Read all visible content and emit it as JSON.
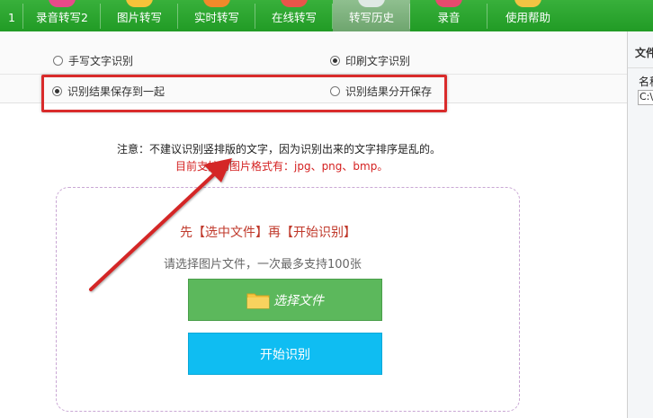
{
  "toolbar": {
    "tabs": [
      {
        "label": "1"
      },
      {
        "label": "录音转写2"
      },
      {
        "label": "图片转写"
      },
      {
        "label": "实时转写"
      },
      {
        "label": "在线转写"
      },
      {
        "label": "转写历史"
      },
      {
        "label": "录音"
      },
      {
        "label": "使用帮助"
      }
    ],
    "active_tab": "转写历史",
    "tab_icon_colors": [
      "#e84a8a",
      "#f1a02b",
      "#f4c33a",
      "#f08a2a",
      "#e9554a",
      "#dfe9e4",
      "#e74a6e",
      "#f2c443"
    ]
  },
  "options": {
    "handwriting_label": "手写文字识别",
    "print_label": "印刷文字识别",
    "save_together_label": "识别结果保存到一起",
    "save_separate_label": "识别结果分开保存",
    "recognition_mode": "印刷文字识别",
    "save_mode": "识别结果保存到一起"
  },
  "notes": {
    "line1": "注意：不建议识别竖排版的文字，因为识别出来的文字排序是乱的。",
    "line2": "目前支持的图片格式有：jpg、png、bmp。"
  },
  "upload": {
    "heading": "先【选中文件】再【开始识别】",
    "subheading": "请选择图片文件，一次最多支持100张",
    "select_button_label": "选择文件",
    "start_button_label": "开始识别"
  },
  "side_panel": {
    "title": "文件",
    "column_header": "名称",
    "row1": "C:\\"
  },
  "colors": {
    "toolbar_green": "#2aa52e",
    "highlight_red": "#d92b2b",
    "select_button": "#5cb85c",
    "start_button": "#0fbdf2",
    "note_red": "#d42020"
  }
}
